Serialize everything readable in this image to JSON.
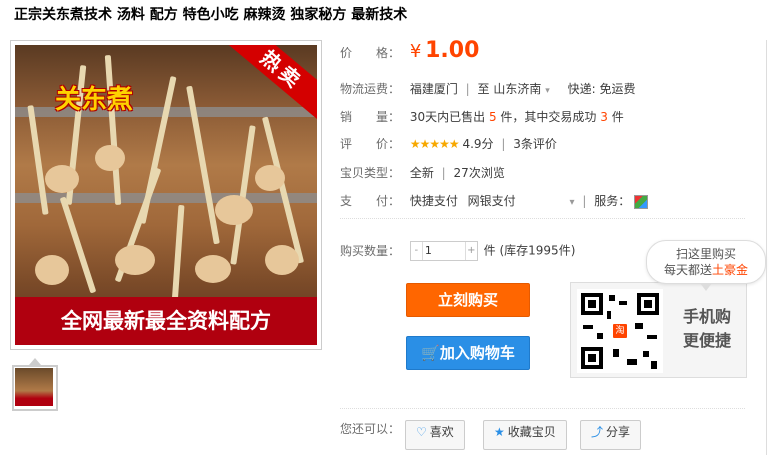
{
  "title": "正宗关东煮技术 汤料 配方 特色小吃 麻辣烫 独家秘方 最新技术",
  "image": {
    "overlay_title": "关东煮",
    "hot_badge": "热卖",
    "banner": "全网最新最全资料配方"
  },
  "price": {
    "label": "价　　格：",
    "symbol": "¥",
    "value": "1.00"
  },
  "shipping": {
    "label": "物流运费：",
    "from": "福建厦门",
    "to_prefix": "至",
    "to": "山东济南",
    "express": "快递: 免运费"
  },
  "sales": {
    "label": "销　　量：",
    "prefix": "30天内已售出",
    "sold": "5",
    "mid": "件，其中交易成功",
    "success": "3",
    "suffix": "件"
  },
  "rating": {
    "label": "评　　价：",
    "stars": "★★★★★",
    "score": "4.9分",
    "reviews": "3条评价"
  },
  "item_type": {
    "label": "宝贝类型：",
    "condition": "全新",
    "views": "27次浏览"
  },
  "payment": {
    "label": "支　　付：",
    "methods": [
      "快捷支付",
      "网银支付"
    ],
    "dropdown": "▾",
    "service_label": "服务："
  },
  "purchase": {
    "qty_label": "购买数量：",
    "minus": "-",
    "qty_value": "1",
    "plus": "+",
    "stock": "件 (库存1995件)",
    "buy_now": "立刻购买",
    "cart_icon": "🛒",
    "add_cart": "加入购物车"
  },
  "mobile": {
    "bubble_line1": "扫这里购买",
    "bubble_line2_pre": "每天都送",
    "bubble_line2_hl": "土豪金",
    "qr_center": "淘",
    "text_line1": "手机购",
    "text_line2": "更便捷"
  },
  "bottom": {
    "label": "您还可以：",
    "share_btn": "喜欢",
    "fav_btn": "收藏宝贝",
    "share2_btn": "分享"
  },
  "colors": {
    "accent": "#ff4400",
    "buy": "#ff6600",
    "cart": "#2a8fe6",
    "star": "#f7a800"
  }
}
